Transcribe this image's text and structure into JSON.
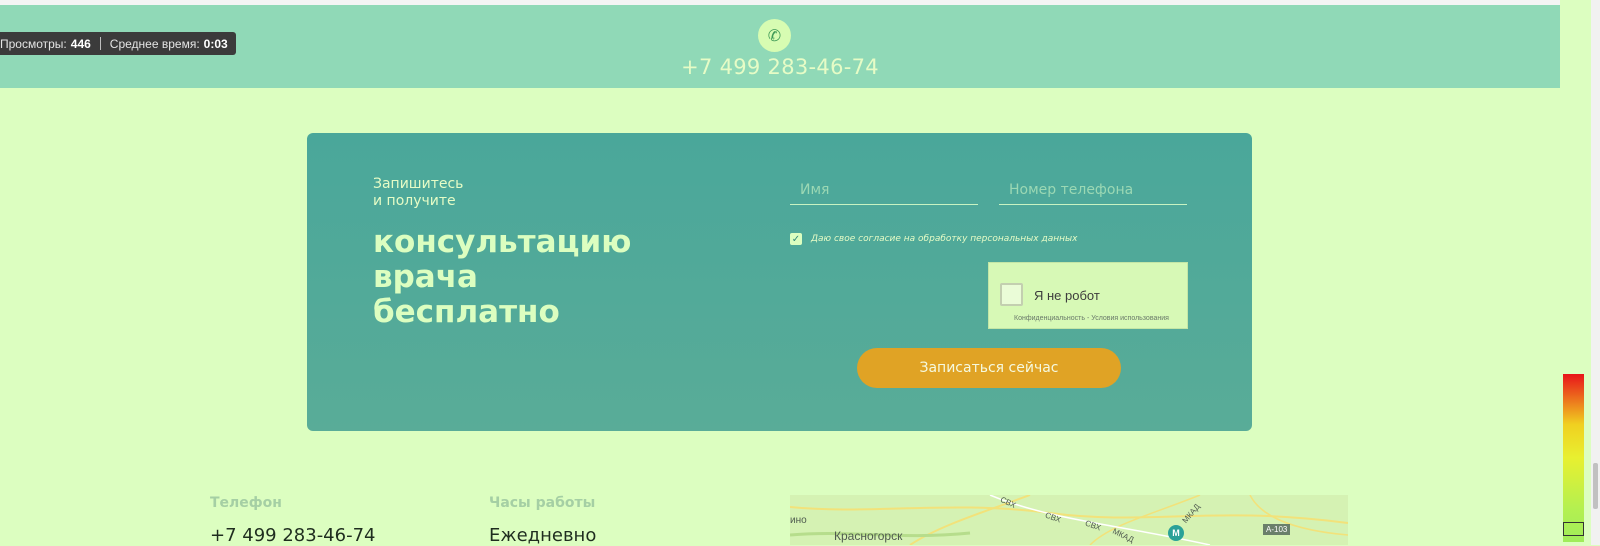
{
  "header": {
    "phone": "+7 499 283-46-74",
    "phone_icon": "phone-icon",
    "band_color": "#90d9b7"
  },
  "stats": {
    "views_label": "Просмотры:",
    "views_value": "446",
    "time_label": "Среднее время:",
    "time_value": "0:03"
  },
  "form": {
    "pre_title_line1": "Запишитесь",
    "pre_title_line2": "и получите",
    "title_line1": "консультацию",
    "title_line2": "врача",
    "title_line3": "бесплатно",
    "name_placeholder": "Имя",
    "phone_placeholder": "Номер телефона",
    "consent_text": "Даю свое согласие на обработку персональных данных",
    "consent_checked": true,
    "captcha_label": "Я не робот",
    "captcha_links": "Конфиденциальность - Условия использования",
    "submit_label": "Записаться сейчас",
    "button_color": "#e0a325",
    "card_color": "#4aa79a"
  },
  "contacts": {
    "phone_label": "Телефон",
    "phone_value": "+7 499 283-46-74",
    "hours_label": "Часы работы",
    "hours_value": "Ежедневно"
  },
  "map": {
    "labels": {
      "ino": "ино",
      "city": "Красногорск",
      "svh1": "СВХ",
      "svh2": "СВХ",
      "svh3": "СВХ",
      "mkad": "МКАД",
      "mkad2": "МКАД",
      "road": "А-103",
      "metro": "М"
    }
  }
}
